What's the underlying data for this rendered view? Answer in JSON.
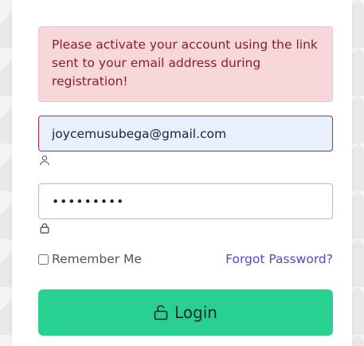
{
  "alert": {
    "message": "Please activate your account using the link sent to your email address during registration!"
  },
  "email_field": {
    "value": "joycemusubega@gmail.com",
    "icon": "user-icon"
  },
  "password_field": {
    "value": "•••••••••",
    "icon": "lock-icon"
  },
  "remember": {
    "label": "Remember Me",
    "checked": false
  },
  "forgot_link": {
    "label": "Forgot Password?"
  },
  "login_button": {
    "label": "Login",
    "icon": "unlock-icon"
  },
  "colors": {
    "alert_bg": "#f8d7da",
    "alert_text": "#842029",
    "email_bg": "#e8f0fe",
    "email_border": "#b02a37",
    "link": "#4a4ac8",
    "login_bg": "#28d192"
  }
}
